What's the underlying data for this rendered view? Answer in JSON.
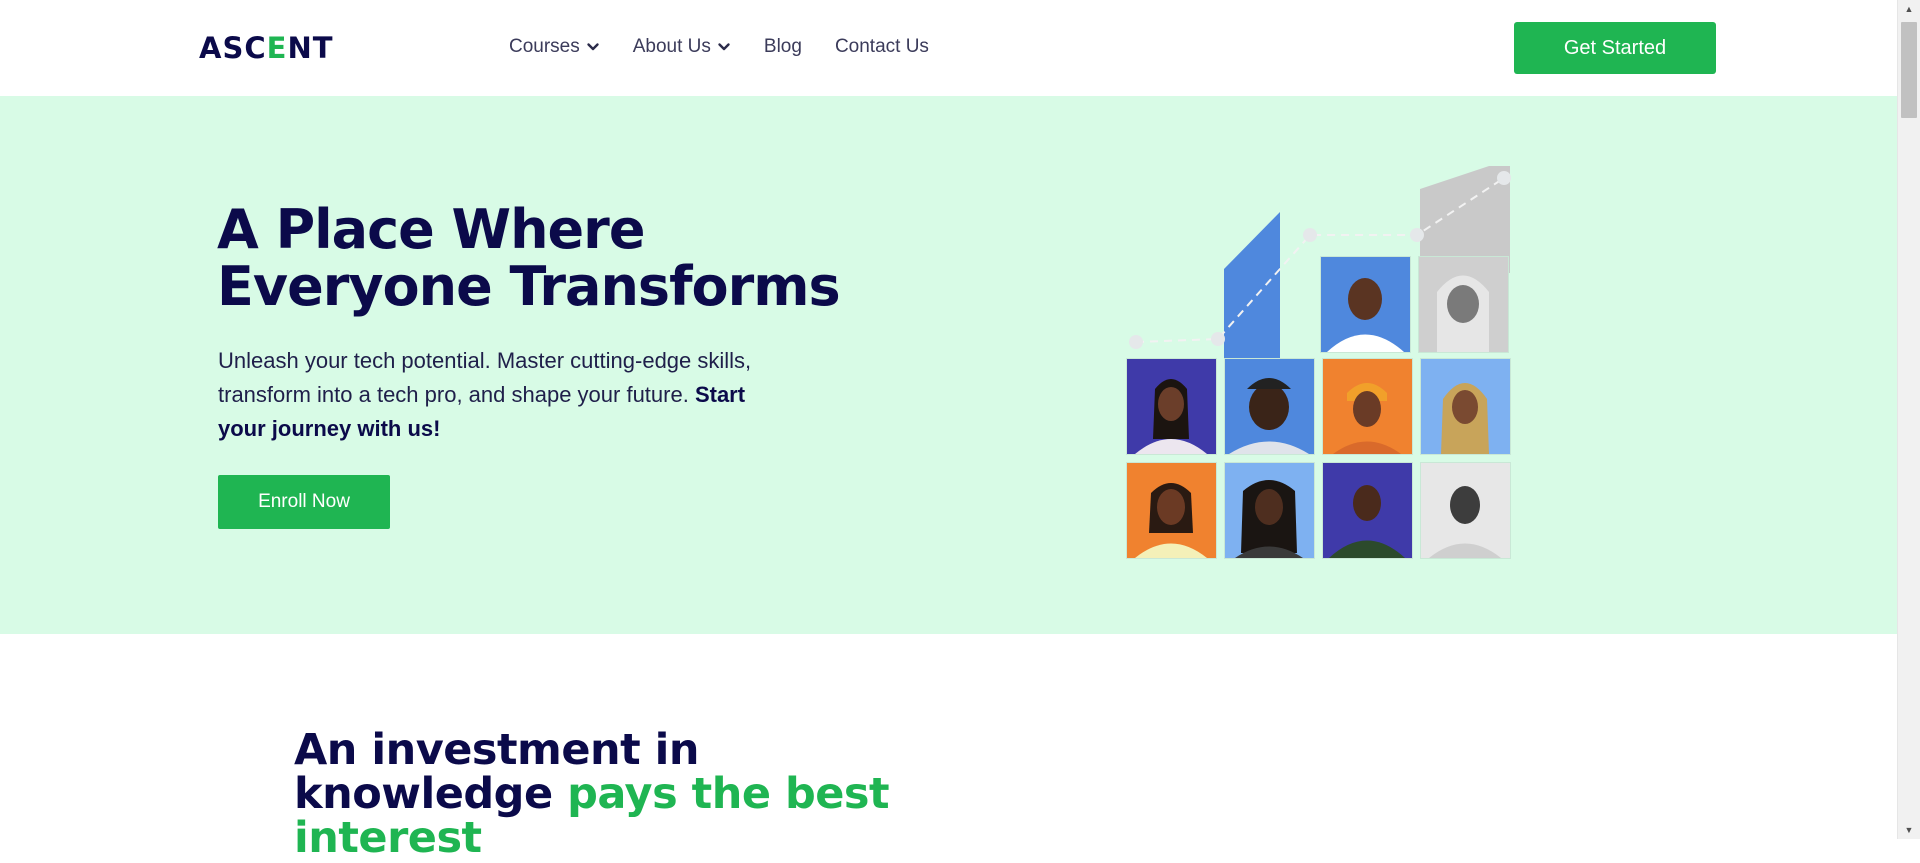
{
  "header": {
    "logo": {
      "before": "ASC",
      "accent_letter": "E",
      "after": "NT"
    },
    "nav": [
      {
        "label": "Courses",
        "has_dropdown": true
      },
      {
        "label": "About Us",
        "has_dropdown": true
      },
      {
        "label": "Blog",
        "has_dropdown": false
      },
      {
        "label": "Contact Us",
        "has_dropdown": false
      }
    ],
    "cta_label": "Get Started"
  },
  "hero": {
    "title_line1": "A Place Where",
    "title_line2": "Everyone Transforms",
    "subtitle_text": "Unleash your tech potential. Master cutting-edge skills, transform into a tech pro, and shape your future. ",
    "subtitle_bold": "Start your journey with us!",
    "enroll_label": "Enroll Now"
  },
  "investment": {
    "title_part1": "An investment in knowledge ",
    "title_green": "pays the best interest"
  },
  "colors": {
    "brand_green": "#1fb552",
    "navy": "#0b0a4a",
    "hero_bg": "#d8fbe6"
  },
  "icons": {
    "chevron": "chevron-down-icon",
    "scroll_up": "scroll-up-arrow-icon",
    "scroll_down": "scroll-down-arrow-icon"
  }
}
